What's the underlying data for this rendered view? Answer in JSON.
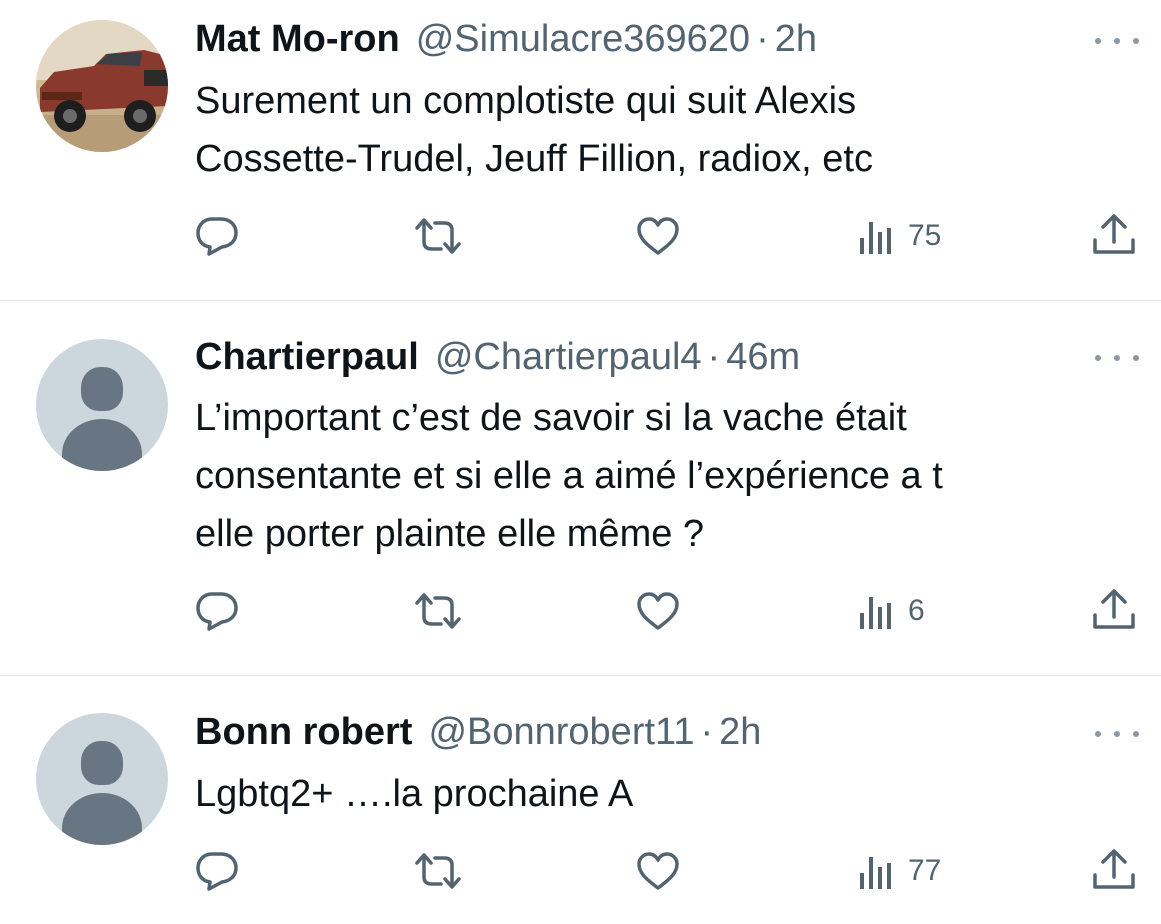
{
  "tweets": [
    {
      "name": "Mat Mo-ron",
      "handle": "@Simulacre369620",
      "separator": "·",
      "time": "2h",
      "avatar": "car-photo",
      "lines": [
        "Surement un complotiste qui suit Alexis",
        "Cossette-Trudel, Jeuff Fillion, radiox, etc"
      ],
      "views": "75"
    },
    {
      "name": "Chartierpaul",
      "handle": "@Chartierpaul4",
      "separator": "·",
      "time": "46m",
      "avatar": "default-profile",
      "lines": [
        "L’important c’est de savoir si la vache était",
        "consentante et si elle a aimé l’expérience a t",
        "elle porter plainte elle même ?"
      ],
      "views": "6"
    },
    {
      "name": "Bonn robert",
      "handle": "@Bonnrobert11",
      "separator": "·",
      "time": "2h",
      "avatar": "default-profile",
      "lines": [
        "Lgbtq2+ ….la prochaine A"
      ],
      "views": "77"
    }
  ],
  "icons": [
    "more-icon",
    "reply-icon",
    "retweet-icon",
    "like-icon",
    "views-icon",
    "share-icon"
  ],
  "colors": {
    "text": "#0f1419",
    "secondary": "#536471",
    "divider": "#e3e6e8",
    "default_avatar_bg": "#ccd6dd",
    "default_avatar_fg": "#687684"
  }
}
